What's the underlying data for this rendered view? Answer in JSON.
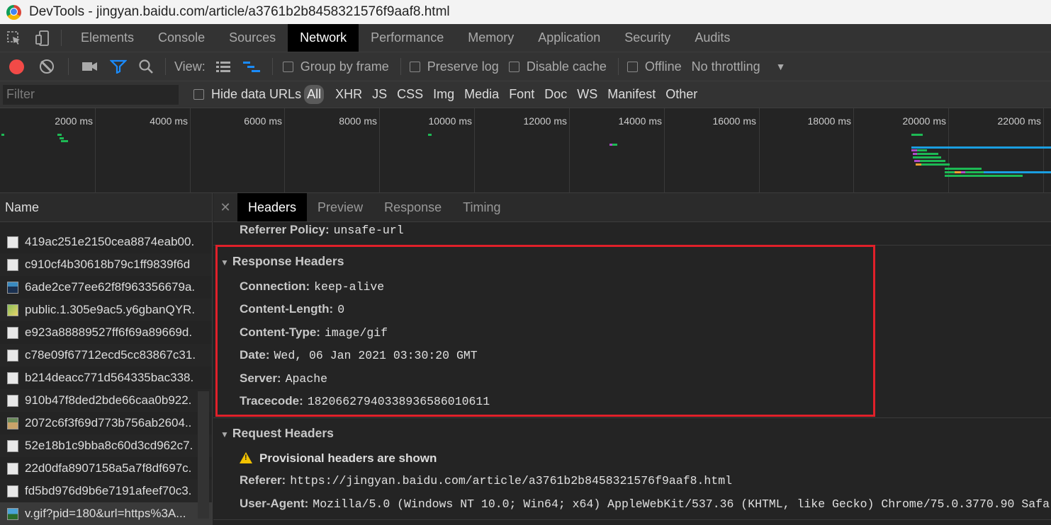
{
  "window": {
    "title": "DevTools - jingyan.baidu.com/article/a3761b2b8458321576f9aaf8.html"
  },
  "tabs": [
    {
      "label": "Elements"
    },
    {
      "label": "Console"
    },
    {
      "label": "Sources"
    },
    {
      "label": "Network"
    },
    {
      "label": "Performance"
    },
    {
      "label": "Memory"
    },
    {
      "label": "Application"
    },
    {
      "label": "Security"
    },
    {
      "label": "Audits"
    }
  ],
  "active_tab": "Network",
  "toolbar": {
    "view_label": "View:",
    "group_by_frame": "Group by frame",
    "preserve_log": "Preserve log",
    "disable_cache": "Disable cache",
    "offline": "Offline",
    "throttling": "No throttling"
  },
  "filter": {
    "placeholder": "Filter",
    "hide_data_urls": "Hide data URLs",
    "types": [
      "All",
      "XHR",
      "JS",
      "CSS",
      "Img",
      "Media",
      "Font",
      "Doc",
      "WS",
      "Manifest",
      "Other"
    ]
  },
  "overview": {
    "ticks": [
      "2000 ms",
      "4000 ms",
      "6000 ms",
      "8000 ms",
      "10000 ms",
      "12000 ms",
      "14000 ms",
      "16000 ms",
      "18000 ms",
      "20000 ms",
      "22000 ms"
    ]
  },
  "name_column": {
    "header": "Name",
    "rows": [
      {
        "name": "419ac251e2150cea8874eab00.",
        "icon": "file-icon"
      },
      {
        "name": "c910cf4b30618b79c1ff9839f6d",
        "icon": "file-icon"
      },
      {
        "name": "6ade2ce77ee62f8f963356679a.",
        "icon": "image-icon"
      },
      {
        "name": "public.1.305e9ac5.y6gbanQYR.",
        "icon": "thumbnail-icon"
      },
      {
        "name": "e923a88889527ff6f69a89669d.",
        "icon": "file-icon"
      },
      {
        "name": "c78e09f67712ecd5cc83867c31.",
        "icon": "file-icon"
      },
      {
        "name": "b214deacc771d564335bac338.",
        "icon": "file-icon"
      },
      {
        "name": "910b47f8ded2bde66caa0b922.",
        "icon": "file-icon"
      },
      {
        "name": "2072c6f3f69d773b756ab2604..",
        "icon": "image-icon"
      },
      {
        "name": "52e18b1c9bba8c60d3cd962c7.",
        "icon": "file-icon"
      },
      {
        "name": "22d0dfa8907158a5a7f8df697c.",
        "icon": "file-icon"
      },
      {
        "name": "fd5bd976d9b6e7191afeef70c3.",
        "icon": "file-icon"
      },
      {
        "name": "v.gif?pid=180&url=https%3A...",
        "icon": "gif-icon"
      }
    ]
  },
  "details": {
    "tabs": [
      "Headers",
      "Preview",
      "Response",
      "Timing"
    ],
    "active_tab": "Headers",
    "referrer_policy": {
      "key": "Referrer Policy:",
      "value": "unsafe-url"
    },
    "response_headers": {
      "title": "Response Headers",
      "items": [
        {
          "key": "Connection:",
          "value": "keep-alive"
        },
        {
          "key": "Content-Length:",
          "value": "0"
        },
        {
          "key": "Content-Type:",
          "value": "image/gif"
        },
        {
          "key": "Date:",
          "value": "Wed, 06 Jan 2021 03:30:20 GMT"
        },
        {
          "key": "Server:",
          "value": "Apache"
        },
        {
          "key": "Tracecode:",
          "value": "18206627940338936586010611"
        }
      ]
    },
    "request_headers": {
      "title": "Request Headers",
      "warning": "Provisional headers are shown",
      "items": [
        {
          "key": "Referer:",
          "value": "https://jingyan.baidu.com/article/a3761b2b8458321576f9aaf8.html"
        },
        {
          "key": "User-Agent:",
          "value": "Mozilla/5.0 (Windows NT 10.0; Win64; x64) AppleWebKit/537.36 (KHTML, like Gecko) Chrome/75.0.3770.90 Safa"
        }
      ]
    }
  },
  "colors": {
    "record": "#f24a47",
    "highlight_box": "#e0202a",
    "filter_icon": "#1a8cff"
  }
}
